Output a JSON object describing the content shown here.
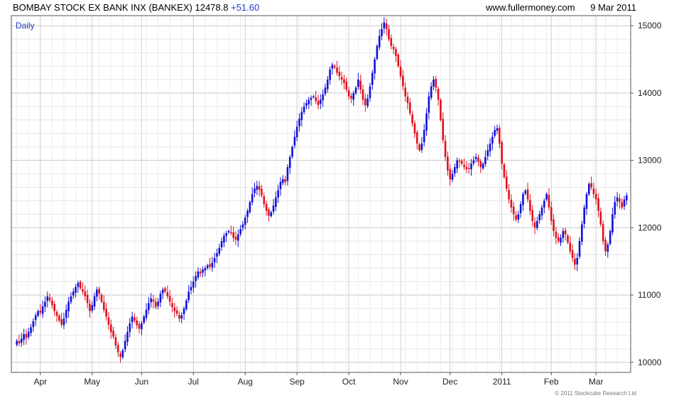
{
  "header": {
    "title": "BOMBAY STOCK EX BANK INX (BANKEX)",
    "last": "12478.8",
    "change": "+51.60",
    "site": "www.fullermoney.com",
    "date": "9 Mar 2011"
  },
  "copyright": "© 2011 Stockcube Research Ltd",
  "colors": {
    "up": "#1010d8",
    "down": "#e0101e",
    "grid": "#d4d4d4",
    "frame": "#555555"
  },
  "chart_data": {
    "type": "candlestick",
    "period_label": "Daily",
    "ylim": [
      9850,
      15150
    ],
    "y_ticks": [
      10000,
      11000,
      12000,
      13000,
      14000,
      15000
    ],
    "y_tick_labels": [
      "10000",
      "11000",
      "12000",
      "13000",
      "14000",
      "15000"
    ],
    "x_tick_labels": [
      "Apr",
      "May",
      "Jun",
      "Jul",
      "Aug",
      "Sep",
      "Oct",
      "Nov",
      "Dec",
      "2011",
      "Feb",
      "Mar"
    ],
    "x_tick_sessions": [
      10,
      32,
      53,
      75,
      97,
      119,
      141,
      163,
      184,
      206,
      227,
      246
    ],
    "grid": true,
    "axis_side": "right",
    "closes": [
      10320,
      10280,
      10350,
      10420,
      10360,
      10450,
      10520,
      10610,
      10700,
      10760,
      10740,
      10830,
      10900,
      10980,
      10920,
      10850,
      10760,
      10690,
      10620,
      10560,
      10650,
      10780,
      10900,
      10980,
      11050,
      11120,
      11180,
      11100,
      11050,
      10980,
      10880,
      10760,
      10850,
      10980,
      11080,
      11020,
      10900,
      10780,
      10680,
      10560,
      10450,
      10380,
      10250,
      10150,
      10080,
      10180,
      10320,
      10450,
      10580,
      10680,
      10620,
      10550,
      10500,
      10580,
      10680,
      10780,
      10880,
      10950,
      10900,
      10820,
      10900,
      11020,
      11080,
      11050,
      10980,
      10900,
      10820,
      10760,
      10720,
      10650,
      10700,
      10800,
      10920,
      11050,
      11120,
      11200,
      11280,
      11350,
      11320,
      11380,
      11400,
      11440,
      11420,
      11480,
      11550,
      11620,
      11700,
      11800,
      11880,
      11920,
      11950,
      11930,
      11850,
      11820,
      11900,
      11980,
      12050,
      12150,
      12250,
      12380,
      12500,
      12580,
      12620,
      12560,
      12480,
      12350,
      12250,
      12180,
      12230,
      12330,
      12450,
      12560,
      12680,
      12720,
      12680,
      12900,
      13050,
      13200,
      13350,
      13500,
      13620,
      13720,
      13800,
      13850,
      13900,
      13930,
      13950,
      13880,
      13820,
      13900,
      13980,
      14080,
      14200,
      14350,
      14420,
      14380,
      14300,
      14250,
      14200,
      14150,
      14050,
      13950,
      13920,
      14000,
      14080,
      14200,
      14050,
      13900,
      13820,
      13920,
      14100,
      14300,
      14500,
      14700,
      14850,
      14950,
      15050,
      14950,
      14800,
      14700,
      14650,
      14550,
      14400,
      14250,
      14100,
      13950,
      13850,
      13700,
      13550,
      13400,
      13250,
      13150,
      13250,
      13450,
      13700,
      13950,
      14100,
      14200,
      14080,
      13900,
      13600,
      13300,
      13050,
      12850,
      12720,
      12800,
      12900,
      13000,
      12980,
      12950,
      12900,
      12870,
      12880,
      12950,
      13000,
      13050,
      12980,
      12900,
      12950,
      13050,
      13150,
      13250,
      13350,
      13450,
      13480,
      13250,
      12950,
      12750,
      12580,
      12420,
      12300,
      12200,
      12120,
      12200,
      12350,
      12500,
      12550,
      12420,
      12250,
      12100,
      12000,
      12100,
      12200,
      12300,
      12400,
      12500,
      12300,
      12100,
      11950,
      11850,
      11800,
      11850,
      11950,
      11900,
      11780,
      11650,
      11550,
      11450,
      11550,
      11800,
      12050,
      12300,
      12500,
      12650,
      12600,
      12500,
      12420,
      12250,
      12050,
      11800,
      11650,
      11750,
      11950,
      12200,
      12380,
      12450,
      12380,
      12300,
      12420,
      12478.8
    ]
  }
}
